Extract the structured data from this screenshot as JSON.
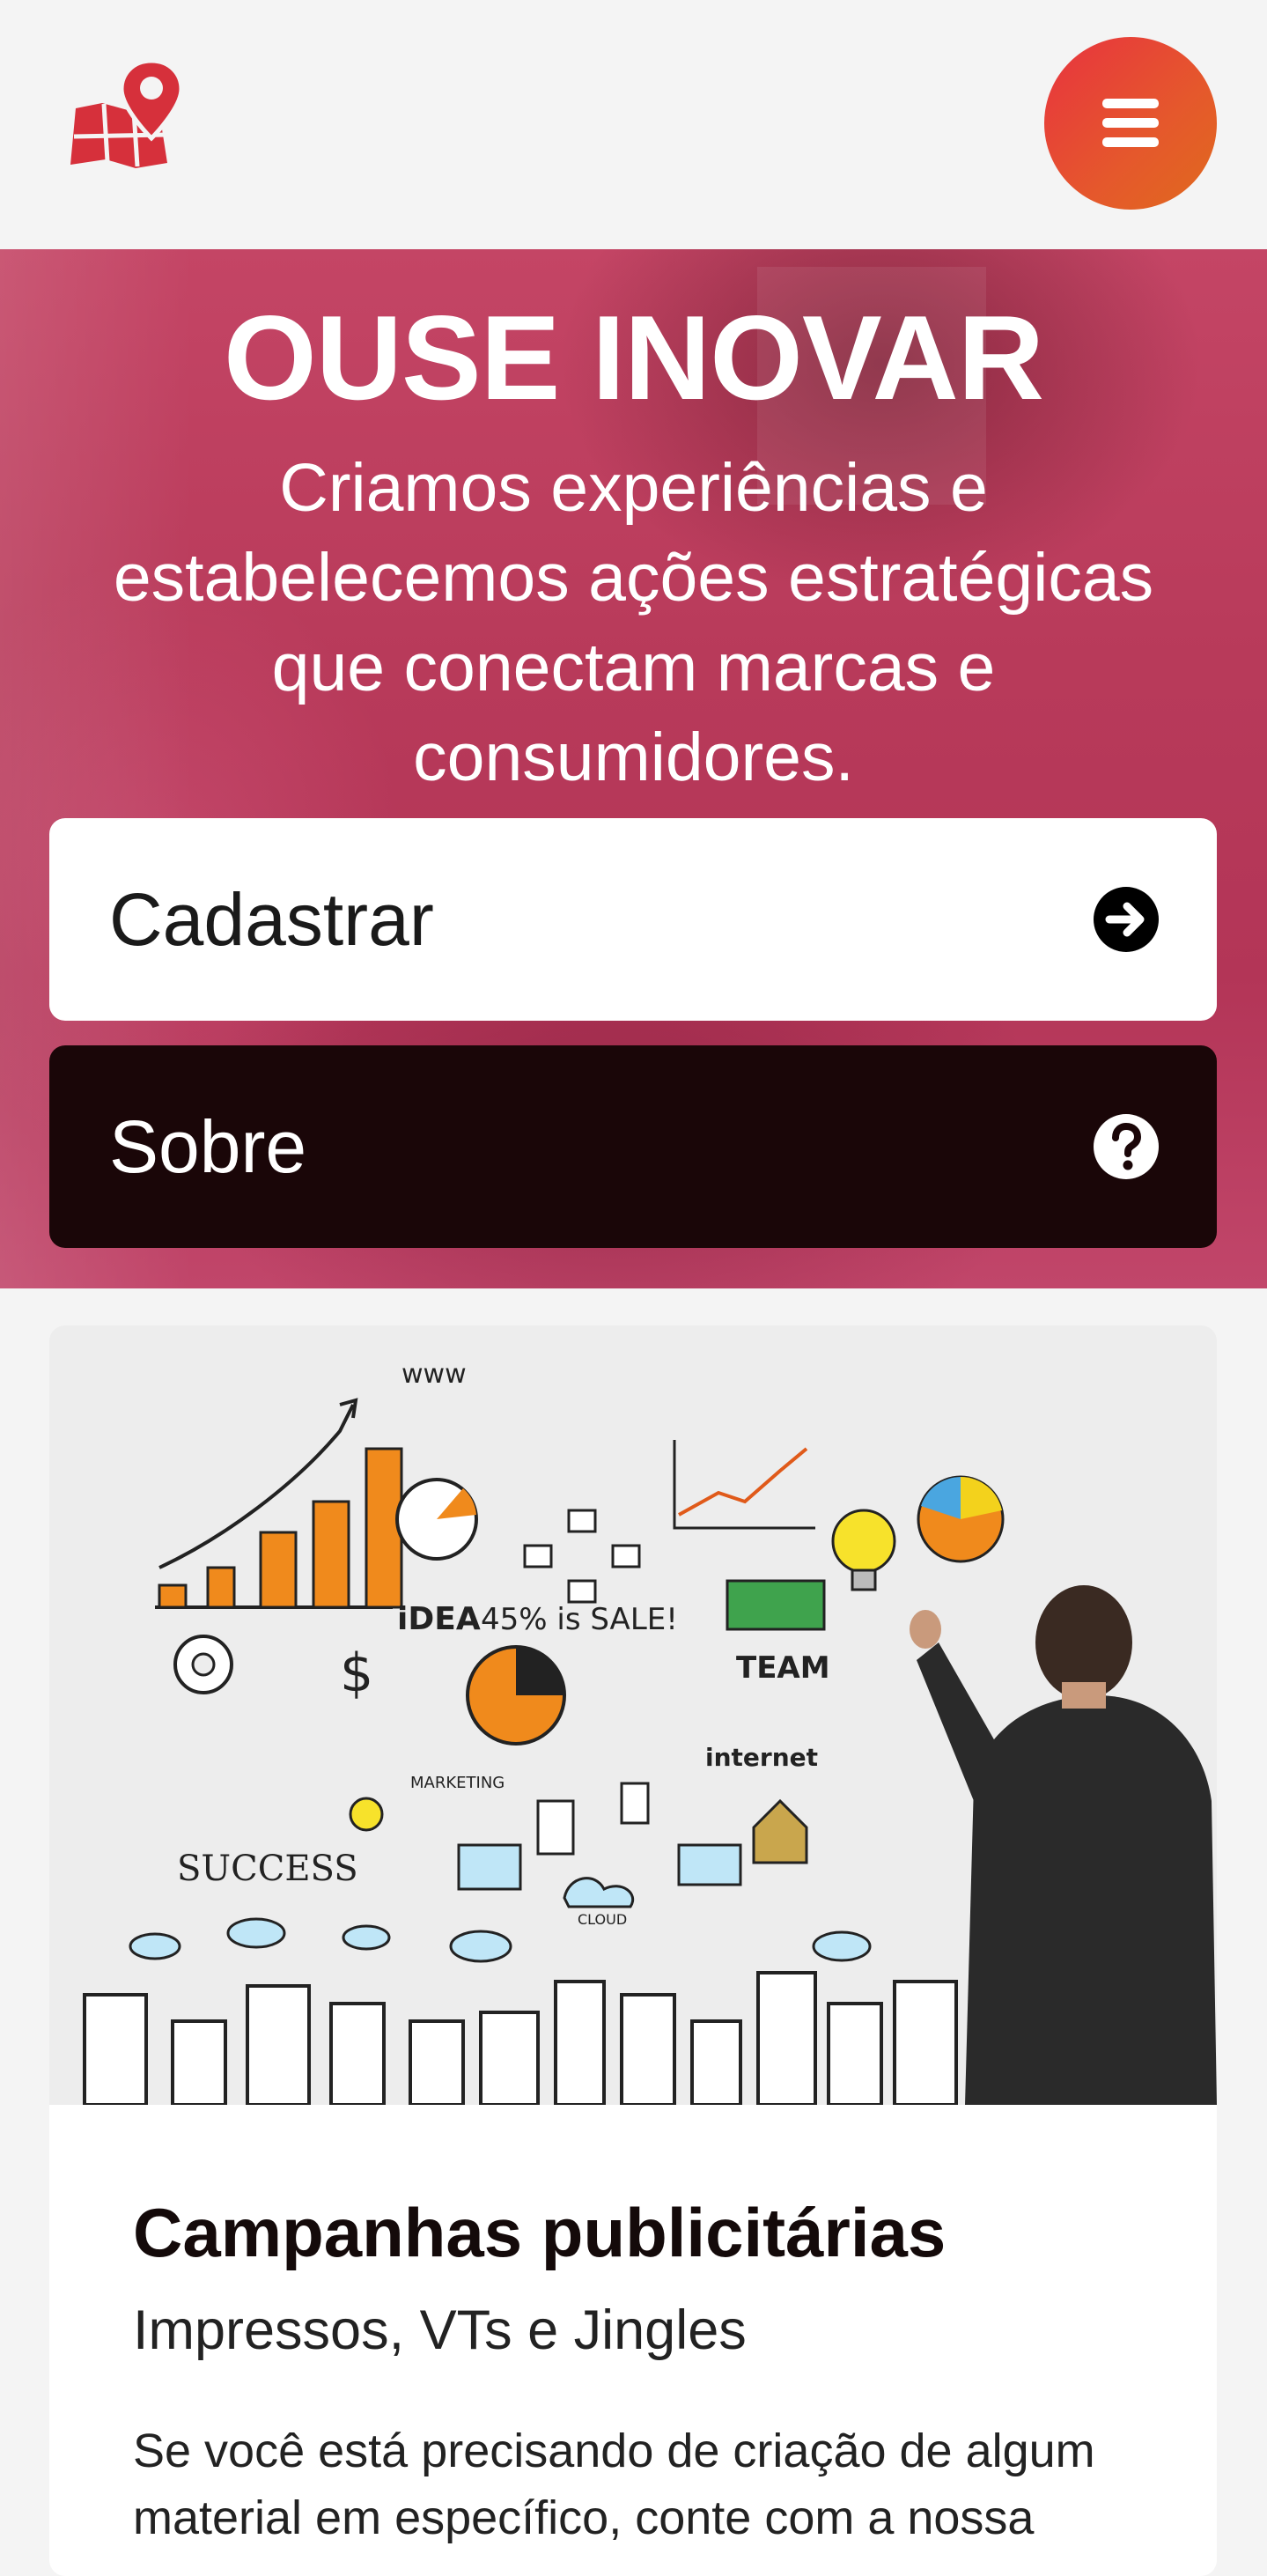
{
  "header": {
    "logo_icon": "map-pin-logo-icon",
    "menu_icon": "hamburger-menu-icon",
    "brand_red": "#d6303b",
    "menu_gradient": [
      "#e8333f",
      "#e06a1d"
    ]
  },
  "hero": {
    "title": "OUSE INOVAR",
    "subtitle": "Criamos experiências e estabelecemos ações estratégicas que conectam marcas e consumidores.",
    "primary_button": {
      "label": "Cadastrar",
      "icon": "arrow-right-circle-icon"
    },
    "secondary_button": {
      "label": "Sobre",
      "icon": "question-circle-icon"
    }
  },
  "card": {
    "image": "business-concept-whiteboard-illustration",
    "title": "Campanhas publicitárias",
    "subtitle": "Impressos, VTs e Jingles",
    "body": "Se você está precisando de criação de algum material em específico, conte com a nossa"
  }
}
